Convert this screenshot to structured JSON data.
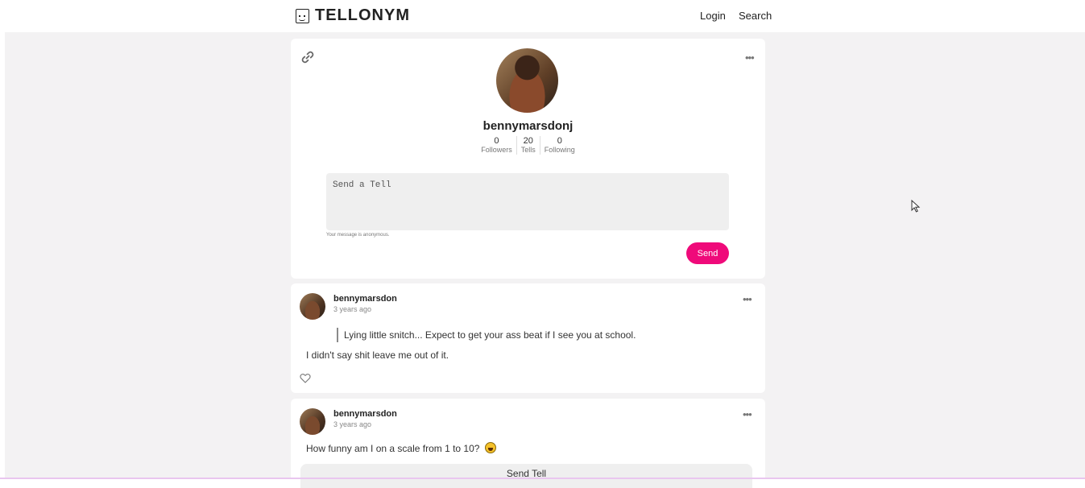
{
  "app": {
    "logo_text": "TELLONYM",
    "nav": {
      "login": "Login",
      "search": "Search"
    }
  },
  "profile": {
    "username": "bennymarsdonj",
    "stats": [
      {
        "value": "0",
        "label": "Followers"
      },
      {
        "value": "20",
        "label": "Tells"
      },
      {
        "value": "0",
        "label": "Following"
      }
    ],
    "tell_placeholder": "Send a Tell",
    "anonymous_note": "Your message is anonymous.",
    "send_label": "Send",
    "more_label": "•••"
  },
  "tells": [
    {
      "author": "bennymarsdon",
      "time": "3 years ago",
      "question": "Lying little snitch... Expect to get your ass beat if I see you at school.",
      "answer": "I didn't say shit leave me out of it.",
      "more_label": "•••"
    },
    {
      "author": "bennymarsdon",
      "time": "3 years ago",
      "question": "How funny am I on a scale from 1 to 10?",
      "send_tell_label": "Send Tell",
      "more_label": "•••"
    }
  ],
  "colors": {
    "accent": "#ef0a7a",
    "background": "#f3f2f3"
  },
  "icons": [
    "link-icon",
    "more-icon",
    "heart-icon",
    "emoji-icon",
    "cursor-icon"
  ]
}
